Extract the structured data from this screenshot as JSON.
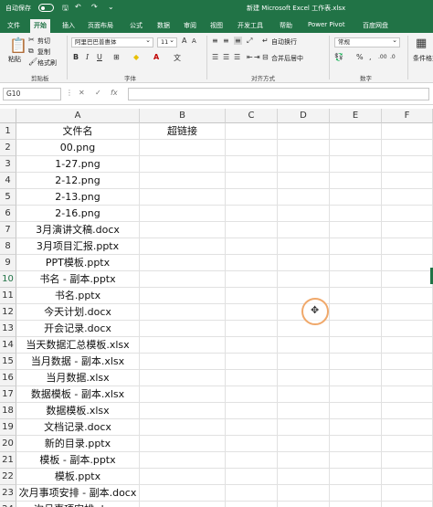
{
  "titlebar": {
    "autosave_label": "自动保存",
    "doc_title": "新建 Microsoft Excel 工作表.xlsx"
  },
  "tabs": [
    "文件",
    "开始",
    "插入",
    "页面布局",
    "公式",
    "数据",
    "审阅",
    "视图",
    "开发工具",
    "帮助",
    "Power Pivot",
    "百度网盘"
  ],
  "ribbon": {
    "paste_label": "粘贴",
    "cut_label": "剪切",
    "copy_label": "复制",
    "format_painter_label": "格式刷",
    "clipboard_group": "剪贴板",
    "font_name": "阿里巴巴普惠体",
    "font_size": "11",
    "font_group": "字体",
    "wrap_text_label": "自动换行",
    "merge_center_label": "合并后居中",
    "alignment_group": "对齐方式",
    "number_format": "常规",
    "number_group": "数字",
    "cond_format_label": "条件格式"
  },
  "formula_bar": {
    "name_box": "G10",
    "fx": "fx",
    "value": ""
  },
  "columns": [
    "A",
    "B",
    "C",
    "D",
    "E",
    "F"
  ],
  "rows": [
    {
      "num": "1",
      "a": "文件名",
      "b": "超链接"
    },
    {
      "num": "2",
      "a": "00.png",
      "b": ""
    },
    {
      "num": "3",
      "a": "1-27.png",
      "b": ""
    },
    {
      "num": "4",
      "a": "2-12.png",
      "b": ""
    },
    {
      "num": "5",
      "a": "2-13.png",
      "b": ""
    },
    {
      "num": "6",
      "a": "2-16.png",
      "b": ""
    },
    {
      "num": "7",
      "a": "3月演讲文稿.docx",
      "b": ""
    },
    {
      "num": "8",
      "a": "3月项目汇报.pptx",
      "b": ""
    },
    {
      "num": "9",
      "a": "PPT模板.pptx",
      "b": ""
    },
    {
      "num": "10",
      "a": "书名 - 副本.pptx",
      "b": ""
    },
    {
      "num": "11",
      "a": "书名.pptx",
      "b": ""
    },
    {
      "num": "12",
      "a": "今天计划.docx",
      "b": ""
    },
    {
      "num": "13",
      "a": "开会记录.docx",
      "b": ""
    },
    {
      "num": "14",
      "a": "当天数据汇总模板.xlsx",
      "b": ""
    },
    {
      "num": "15",
      "a": "当月数据 - 副本.xlsx",
      "b": ""
    },
    {
      "num": "16",
      "a": "当月数据.xlsx",
      "b": ""
    },
    {
      "num": "17",
      "a": "数据模板 - 副本.xlsx",
      "b": ""
    },
    {
      "num": "18",
      "a": "数据模板.xlsx",
      "b": ""
    },
    {
      "num": "19",
      "a": "文档记录.docx",
      "b": ""
    },
    {
      "num": "20",
      "a": "新的目录.pptx",
      "b": ""
    },
    {
      "num": "21",
      "a": "模板 - 副本.pptx",
      "b": ""
    },
    {
      "num": "22",
      "a": "模板.pptx",
      "b": ""
    },
    {
      "num": "23",
      "a": "次月事项安排 - 副本.docx",
      "b": ""
    },
    {
      "num": "24",
      "a": "次月事项安排.docx",
      "b": ""
    }
  ],
  "selected_row": "10"
}
